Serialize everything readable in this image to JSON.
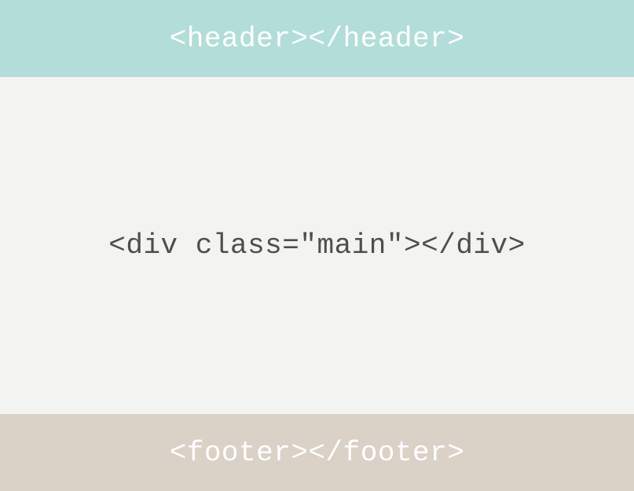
{
  "header": {
    "label": "<header></header>"
  },
  "main": {
    "label": "<div class=\"main\"></div>"
  },
  "footer": {
    "label": "<footer></footer>"
  }
}
